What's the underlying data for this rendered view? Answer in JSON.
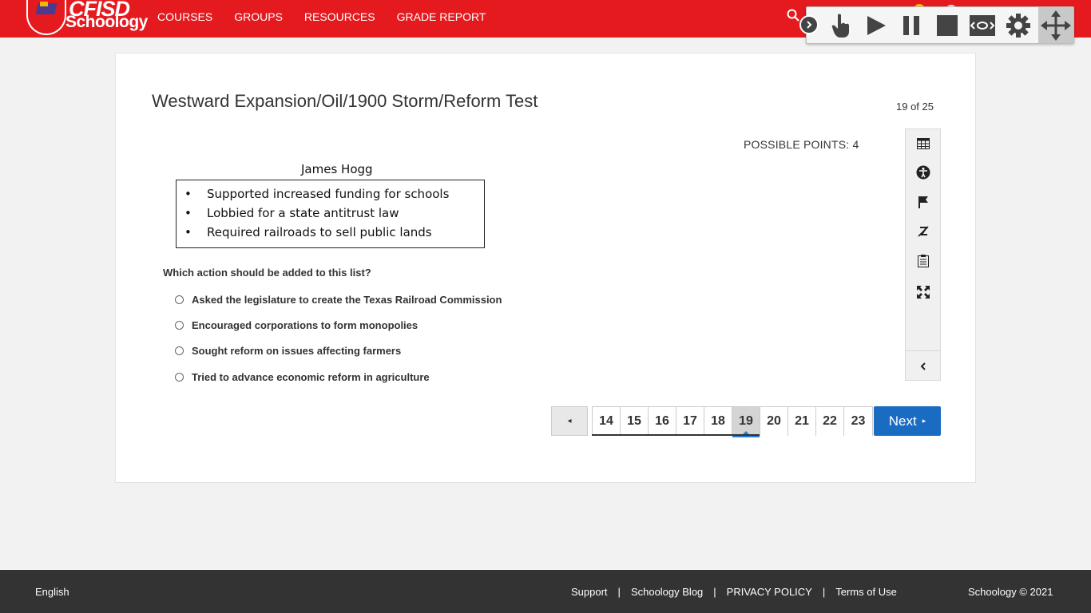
{
  "header": {
    "logo_text": "CFISD",
    "logo_sub": "Schoology",
    "nav": [
      "COURSES",
      "GROUPS",
      "RESOURCES",
      "GRADE REPORT"
    ],
    "colors": {
      "brand": "#e51a1f",
      "accent": "#1a6cc2"
    }
  },
  "toolbar": {
    "icons": [
      "collapse-icon",
      "point-and-click-icon",
      "play-icon",
      "pause-icon",
      "stop-icon",
      "screen-mask-icon",
      "settings-icon",
      "move-icon"
    ]
  },
  "test": {
    "title": "Westward Expansion/Oil/1900 Storm/Reform Test",
    "counter": "19 of 25",
    "points": "POSSIBLE POINTS: 4"
  },
  "stimulus": {
    "title": "James Hogg",
    "items": [
      "Supported increased funding for schools",
      "Lobbied for a state antitrust law",
      "Required railroads to sell public lands"
    ]
  },
  "question": {
    "text": "Which action should be added to this list?",
    "choices": [
      "Asked the legislature to create the Texas Railroad Commission",
      "Encouraged corporations to form monopolies",
      "Sought reform on issues affecting farmers",
      "Tried to advance economic reform in agriculture"
    ]
  },
  "tools": [
    "calculator-icon",
    "accessibility-icon",
    "flag-icon",
    "strikethrough-icon",
    "notepad-icon",
    "fullscreen-icon",
    "collapse-left-icon"
  ],
  "pagination": {
    "prev_label": "◂",
    "pages": [
      "14",
      "15",
      "16",
      "17",
      "18",
      "19",
      "20",
      "21",
      "22",
      "23"
    ],
    "current": "19",
    "next_label": "Next",
    "next_arrow": "▸"
  },
  "footer": {
    "language": "English",
    "links": [
      "Support",
      "Schoology Blog",
      "PRIVACY POLICY",
      "Terms of Use"
    ],
    "separator": "|",
    "copyright": "Schoology © 2021"
  }
}
